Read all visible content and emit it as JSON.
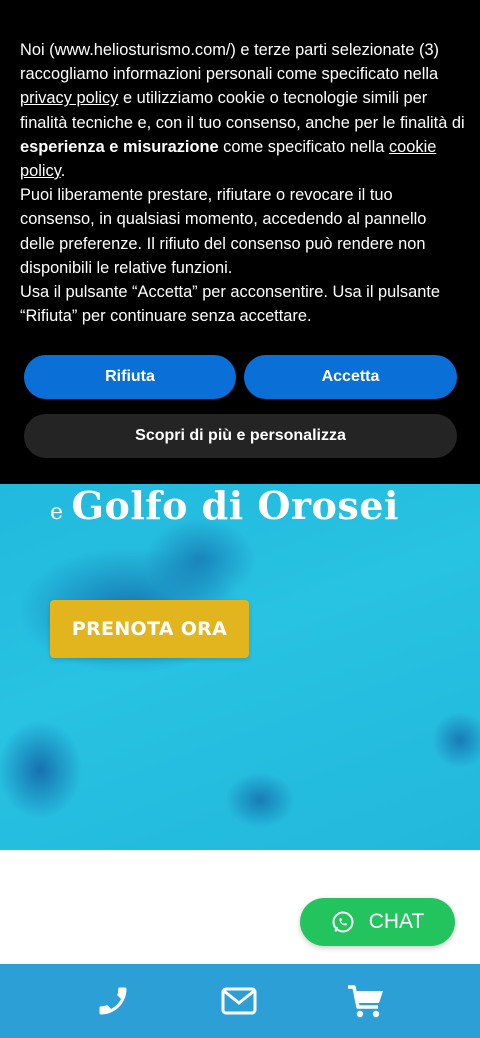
{
  "cookie_banner": {
    "line1_pre": "Noi (www.heliosturismo.com/) e terze parti selezionate (3) raccogliamo informazioni personali come specificato nella ",
    "privacy_link": "privacy policy",
    "line1_mid": " e utilizziamo cookie o tecnologie simili per finalità tecniche e, con il tuo consenso, anche per le finalità di ",
    "bold_text": "esperienza e misurazione",
    "line1_post": " come specificato nella ",
    "cookie_link": "cookie policy",
    "line1_end": ".",
    "paragraph2": "Puoi liberamente prestare, rifiutare o revocare il tuo consenso, in qualsiasi momento, accedendo al pannello delle preferenze. Il rifiuto del consenso può rendere non disponibili le relative funzioni.",
    "paragraph3": "Usa il pulsante “Accetta” per acconsentire. Usa il pulsante “Rifiuta” per continuare senza accettare.",
    "reject_label": "Rifiuta",
    "accept_label": "Accetta",
    "more_label": "Scopri di più e personalizza"
  },
  "hero": {
    "title_small": "e",
    "title": "Golfo di Orosei",
    "book_button": "PRENOTA ORA"
  },
  "chat": {
    "label": "CHAT",
    "icon": "whatsapp-icon"
  },
  "bottom_bar": {
    "icons": [
      "phone-icon",
      "mail-icon",
      "cart-icon"
    ]
  },
  "colors": {
    "banner_bg": "#000000",
    "button_blue": "#0a6fd6",
    "book_yellow": "#e2b51f",
    "chat_green": "#23c45e",
    "bar_blue": "#2b9fd6"
  }
}
